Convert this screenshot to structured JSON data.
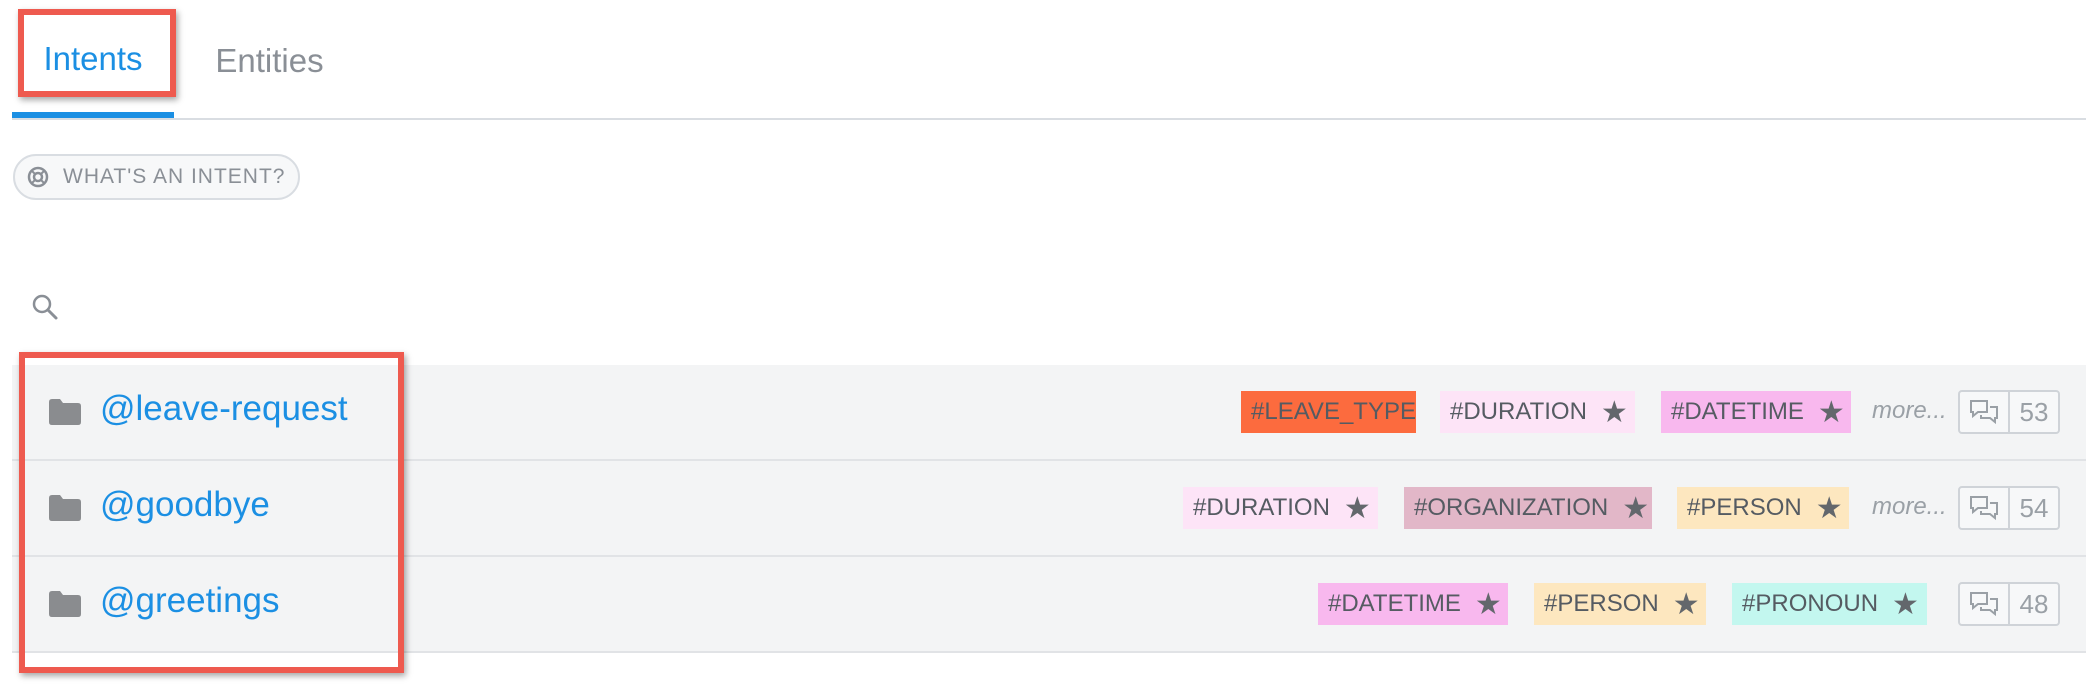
{
  "tabs": {
    "intents": "Intents",
    "entities": "Entities"
  },
  "help": {
    "label": "WHAT'S AN INTENT?"
  },
  "intents": [
    {
      "name": "@leave-request",
      "tags": [
        {
          "label": "#LEAVE_TYPE",
          "starred": false,
          "color": "#fc6b3e"
        },
        {
          "label": "#DURATION",
          "starred": true,
          "color": "#fde4f7"
        },
        {
          "label": "#DATETIME",
          "starred": true,
          "color": "#f8b8ee"
        }
      ],
      "more": "more...",
      "count": "53"
    },
    {
      "name": "@goodbye",
      "tags": [
        {
          "label": "#DURATION",
          "starred": true,
          "color": "#fde4f7"
        },
        {
          "label": "#ORGANIZATION",
          "starred": true,
          "color": "#e2b7c8"
        },
        {
          "label": "#PERSON",
          "starred": true,
          "color": "#fde7bf"
        }
      ],
      "more": "more...",
      "count": "54"
    },
    {
      "name": "@greetings",
      "tags": [
        {
          "label": "#DATETIME",
          "starred": true,
          "color": "#f8b8ee"
        },
        {
          "label": "#PERSON",
          "starred": true,
          "color": "#fde7bf"
        },
        {
          "label": "#PRONOUN",
          "starred": true,
          "color": "#c3f7ef"
        }
      ],
      "more": "",
      "count": "48"
    }
  ],
  "icons": {
    "help": "help-circle-icon",
    "search": "search-icon",
    "folder": "folder-icon",
    "comments": "comments-icon",
    "star": "star-icon"
  },
  "colors": {
    "accent": "#1b8fe3",
    "highlight": "#ee5a4f"
  }
}
